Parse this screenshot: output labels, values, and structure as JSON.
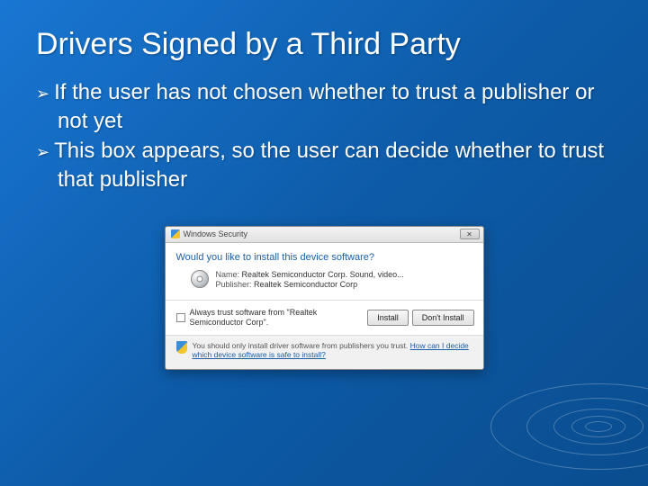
{
  "title": "Drivers Signed by a Third Party",
  "bullets": [
    "If the user has not chosen whether to trust a publisher or not yet",
    "This box appears, so the user can decide whether to trust that publisher"
  ],
  "dialog": {
    "titlebar": "Windows Security",
    "close": "✕",
    "prompt": "Would you like to install this device software?",
    "name_label": "Name:",
    "name_value": "Realtek Semiconductor Corp. Sound, video...",
    "publisher_label": "Publisher:",
    "publisher_value": "Realtek Semiconductor Corp",
    "trust_checkbox": "Always trust software from \"Realtek Semiconductor Corp\".",
    "install": "Install",
    "dont_install": "Don't Install",
    "footer_text": "You should only install driver software from publishers you trust.",
    "footer_link": "How can I decide which device software is safe to install?"
  }
}
